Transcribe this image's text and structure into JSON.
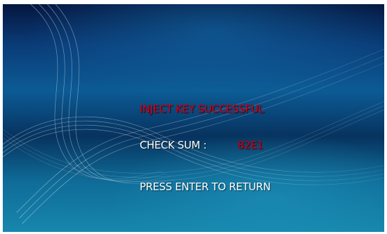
{
  "status": {
    "title": "INJECT KEY SUCCESSFUL",
    "checksum_label": "CHECK SUM :",
    "checksum_value": "82E1",
    "prompt": "PRESS ENTER TO RETURN"
  },
  "colors": {
    "title_red": "#d7001a",
    "text_white": "#ffffff",
    "bg_dark_blue": "#05163f",
    "bg_teal": "#1787ad"
  }
}
